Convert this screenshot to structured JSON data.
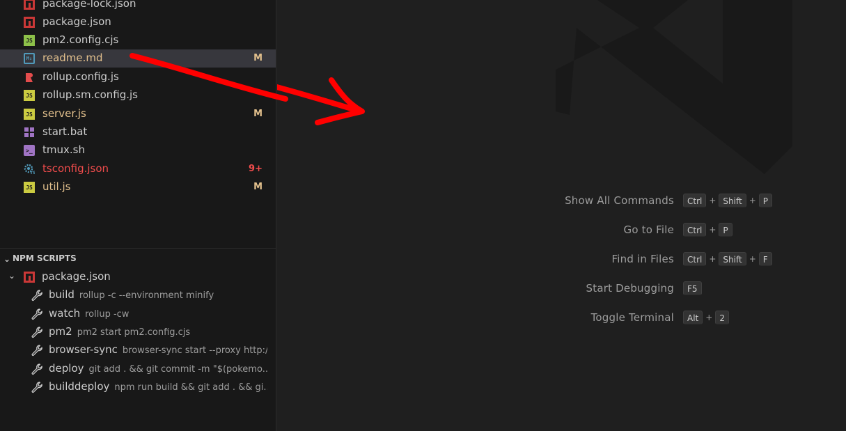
{
  "explorer": {
    "files": [
      {
        "name": "package-lock.json",
        "icon": "npm-icon",
        "status": "",
        "color": "#cccccc",
        "status_color": "#d7ba7d",
        "selected": false
      },
      {
        "name": "package.json",
        "icon": "npm-icon",
        "status": "",
        "color": "#cccccc",
        "status_color": "#d7ba7d",
        "selected": false
      },
      {
        "name": "pm2.config.cjs",
        "icon": "js-icon-green",
        "status": "",
        "color": "#cccccc",
        "status_color": "#d7ba7d",
        "selected": false
      },
      {
        "name": "readme.md",
        "icon": "markdown-icon",
        "status": "M",
        "color": "#e2c08d",
        "status_color": "#e2c08d",
        "selected": true
      },
      {
        "name": "rollup.config.js",
        "icon": "rollup-icon",
        "status": "",
        "color": "#cccccc",
        "status_color": "#d7ba7d",
        "selected": false
      },
      {
        "name": "rollup.sm.config.js",
        "icon": "js-icon",
        "status": "",
        "color": "#cccccc",
        "status_color": "#d7ba7d",
        "selected": false
      },
      {
        "name": "server.js",
        "icon": "js-icon",
        "status": "M",
        "color": "#e2c08d",
        "status_color": "#e2c08d",
        "selected": false
      },
      {
        "name": "start.bat",
        "icon": "windows-icon",
        "status": "",
        "color": "#cccccc",
        "status_color": "#d7ba7d",
        "selected": false
      },
      {
        "name": "tmux.sh",
        "icon": "terminal-icon",
        "status": "",
        "color": "#cccccc",
        "status_color": "#d7ba7d",
        "selected": false
      },
      {
        "name": "tsconfig.json",
        "icon": "tsconfig-gear-icon",
        "status": "9+",
        "color": "#f14c4c",
        "status_color": "#f14c4c",
        "selected": false
      },
      {
        "name": "util.js",
        "icon": "js-icon",
        "status": "M",
        "color": "#e2c08d",
        "status_color": "#e2c08d",
        "selected": false
      }
    ]
  },
  "npm_scripts": {
    "header": "NPM SCRIPTS",
    "package": "package.json",
    "scripts": [
      {
        "name": "build",
        "command": "rollup -c --environment minify"
      },
      {
        "name": "watch",
        "command": "rollup -cw"
      },
      {
        "name": "pm2",
        "command": "pm2 start pm2.config.cjs"
      },
      {
        "name": "browser-sync",
        "command": "browser-sync start --proxy http:/..."
      },
      {
        "name": "deploy",
        "command": "git add . && git commit -m \"$(pokemo..."
      },
      {
        "name": "builddeploy",
        "command": "npm run build && git add . && gi..."
      }
    ]
  },
  "welcome": {
    "commands": [
      {
        "label": "Show All Commands",
        "keys": [
          "Ctrl",
          "Shift",
          "P"
        ]
      },
      {
        "label": "Go to File",
        "keys": [
          "Ctrl",
          "P"
        ]
      },
      {
        "label": "Find in Files",
        "keys": [
          "Ctrl",
          "Shift",
          "F"
        ]
      },
      {
        "label": "Start Debugging",
        "keys": [
          "F5"
        ]
      },
      {
        "label": "Toggle Terminal",
        "keys": [
          "Alt",
          "2"
        ]
      }
    ]
  },
  "colors": {
    "arrow": "#ff0000",
    "watermark": "#181818"
  }
}
